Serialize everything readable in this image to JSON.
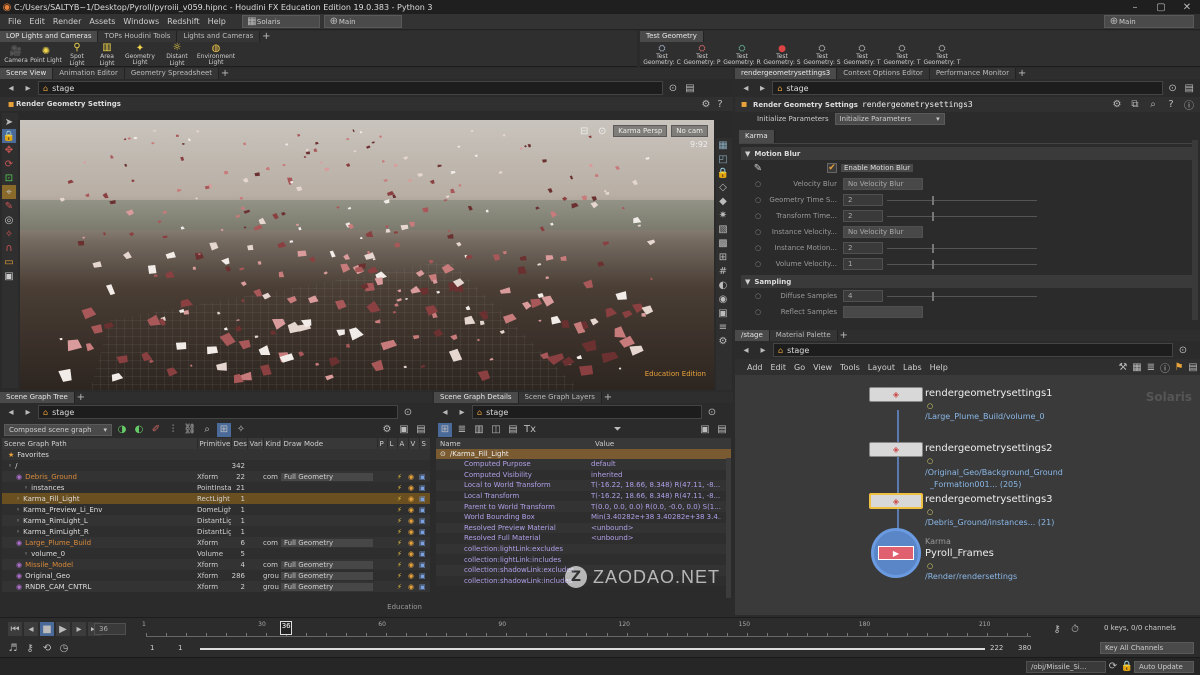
{
  "window": {
    "title": "C:/Users/SALTYB~1/Desktop/Pyroll/pyroiii_v059.hipnc - Houdini FX Education Edition 19.0.383 - Python 3"
  },
  "menu": {
    "items": [
      "File",
      "Edit",
      "Render",
      "Assets",
      "Windows",
      "Redshift",
      "Help"
    ],
    "desktop": "Solaris",
    "context": "Main",
    "right_context": "Main"
  },
  "shelf_left": {
    "tabs": [
      "LOP Lights and Cameras",
      "TOPs Houdini Tools",
      "Lights and Cameras"
    ],
    "tools": [
      "Camera",
      "Point Light",
      "Spot Light",
      "Area Light",
      "Geometry Light",
      "Distant Light",
      "Environment Light"
    ]
  },
  "shelf_right": {
    "tabs": [
      "Test Geometry"
    ],
    "tools": [
      "Test Geometry: C",
      "Test Geometry: P",
      "Test Geometry: R",
      "Test Geometry: S",
      "Test Geometry: S",
      "Test Geometry: T",
      "Test Geometry: T",
      "Test Geometry: T"
    ]
  },
  "viewer": {
    "tabs": [
      "Scene View",
      "Animation Editor",
      "Geometry Spreadsheet"
    ],
    "path": "stage",
    "title": "Render Geometry Settings",
    "camera": "Karma Persp",
    "nocam": "No cam",
    "frame_counter": "9:92",
    "watermark": "Education Edition"
  },
  "param": {
    "tabs": [
      "rendergeometrysettings3",
      "Context Options Editor",
      "Performance Monitor"
    ],
    "path": "stage",
    "node_type": "Render Geometry Settings",
    "node_name": "rendergeometrysettings3",
    "init_label": "Initialize Parameters",
    "init_value": "Initialize Parameters",
    "tab": "Karma",
    "section1": "Motion Blur",
    "enable_label": "Enable Motion Blur",
    "rows": [
      {
        "label": "Velocity Blur",
        "value": "No Velocity Blur"
      },
      {
        "label": "Geometry Time S...",
        "value": "2"
      },
      {
        "label": "Transform Time...",
        "value": "2"
      },
      {
        "label": "Instance Velocity...",
        "value": "No Velocity Blur"
      },
      {
        "label": "Instance Motion...",
        "value": "2"
      },
      {
        "label": "Volume Velocity...",
        "value": "1"
      }
    ],
    "section2": "Sampling",
    "rows2": [
      {
        "label": "Diffuse Samples",
        "value": "4"
      },
      {
        "label": "Reflect Samples",
        "value": ""
      }
    ]
  },
  "network": {
    "tabs": [
      "/stage",
      "Material Palette"
    ],
    "path": "stage",
    "menu": [
      "Add",
      "Edit",
      "Go",
      "View",
      "Tools",
      "Layout",
      "Labs",
      "Help"
    ],
    "context_label": "Solaris",
    "nodes": [
      {
        "name": "rendergeometrysettings1",
        "path": "/Large_Plume_Build/volume_0"
      },
      {
        "name": "rendergeometrysettings2",
        "path": "/Original_Geo/Background_Ground",
        "path2": "_Formation001... (205)"
      },
      {
        "name": "rendergeometrysettings3",
        "path": "/Debris_Ground/instances... (21)"
      },
      {
        "name": "Pyroll_Frames",
        "type": "Karma",
        "path": "/Render/rendersettings"
      }
    ]
  },
  "scene_tree": {
    "tabs": [
      "Scene Graph Tree"
    ],
    "path": "stage",
    "mode": "Composed scene graph",
    "columns": [
      "Scene Graph Path",
      "Primitive",
      "Des",
      "Vari",
      "Kind",
      "Draw Mode",
      "P",
      "L",
      "A",
      "V",
      "S"
    ],
    "rows": [
      {
        "name": "Favorites",
        "prim": "",
        "des": "",
        "kind": "",
        "draw": ""
      },
      {
        "name": "/",
        "prim": "",
        "des": "342",
        "kind": "",
        "draw": ""
      },
      {
        "name": "Debris_Ground",
        "prim": "Xform",
        "des": "22",
        "kind": "com",
        "draw": "Full Geometry"
      },
      {
        "name": "instances",
        "prim": "PointInsta",
        "des": "21",
        "kind": "",
        "draw": ""
      },
      {
        "name": "Karma_Fill_Light",
        "prim": "RectLight",
        "des": "1",
        "kind": "",
        "draw": ""
      },
      {
        "name": "Karma_Preview_Li_Env",
        "prim": "DomeLigh",
        "des": "1",
        "kind": "",
        "draw": ""
      },
      {
        "name": "Karma_RimLight_L",
        "prim": "DistantLig",
        "des": "1",
        "kind": "",
        "draw": ""
      },
      {
        "name": "Karma_RimLight_R",
        "prim": "DistantLig",
        "des": "1",
        "kind": "",
        "draw": ""
      },
      {
        "name": "Large_Plume_Build",
        "prim": "Xform",
        "des": "6",
        "kind": "com",
        "draw": "Full Geometry"
      },
      {
        "name": "volume_0",
        "prim": "Volume",
        "des": "5",
        "kind": "",
        "draw": ""
      },
      {
        "name": "Missile_Model",
        "prim": "Xform",
        "des": "4",
        "kind": "com",
        "draw": "Full Geometry"
      },
      {
        "name": "Original_Geo",
        "prim": "Xform",
        "des": "286",
        "kind": "grou",
        "draw": "Full Geometry"
      },
      {
        "name": "RNDR_CAM_CNTRL",
        "prim": "Xform",
        "des": "2",
        "kind": "grou",
        "draw": "Full Geometry"
      }
    ],
    "watermark": "Education"
  },
  "details": {
    "tabs": [
      "Scene Graph Details",
      "Scene Graph Layers"
    ],
    "path": "stage",
    "columns": [
      "Name",
      "Value"
    ],
    "header_path": "/Karma_Fill_Light",
    "rows": [
      {
        "name": "Computed Purpose",
        "value": "default"
      },
      {
        "name": "Computed Visibility",
        "value": "inherited"
      },
      {
        "name": "Local to World Transform",
        "value": "T(-16.22, 18.66, 8.348) R(47.11, -8..."
      },
      {
        "name": "Local Transform",
        "value": "T(-16.22, 18.66, 8.348) R(47.11, -8..."
      },
      {
        "name": "Parent to World Transform",
        "value": "T(0.0, 0.0, 0.0) R(0.0, -0.0, 0.0) S(1..."
      },
      {
        "name": "World Bounding Box",
        "value": "Min(3.40282e+38 3.40282e+38 3.4..."
      },
      {
        "name": "Resolved Preview Material",
        "value": "<unbound>"
      },
      {
        "name": "Resolved Full Material",
        "value": "<unbound>"
      },
      {
        "name": "collection:lightLink:excludes",
        "value": ""
      },
      {
        "name": "collection:lightLink:includes",
        "value": ""
      },
      {
        "name": "collection:shadowLink:excludes",
        "value": ""
      },
      {
        "name": "collection:shadowLink:includes",
        "value": ""
      }
    ]
  },
  "timeline": {
    "current_frame": "36",
    "ticks": [
      "1",
      "30",
      "60",
      "90",
      "120",
      "150",
      "180",
      "210"
    ],
    "start": "1",
    "start2": "1",
    "end": "222",
    "end2": "380",
    "keys": "0 keys, 0/0 channels",
    "key_all": "Key All Channels",
    "status_path": "/obj/Missile_Si...",
    "auto_update": "Auto Update"
  },
  "watermark": {
    "text": "ZAODAO.NET"
  },
  "colors": {
    "accent": "#e8a23a",
    "node_selected": "#f0c040",
    "link_blue": "#8bb8e8",
    "details_header": "#7a5a30"
  }
}
